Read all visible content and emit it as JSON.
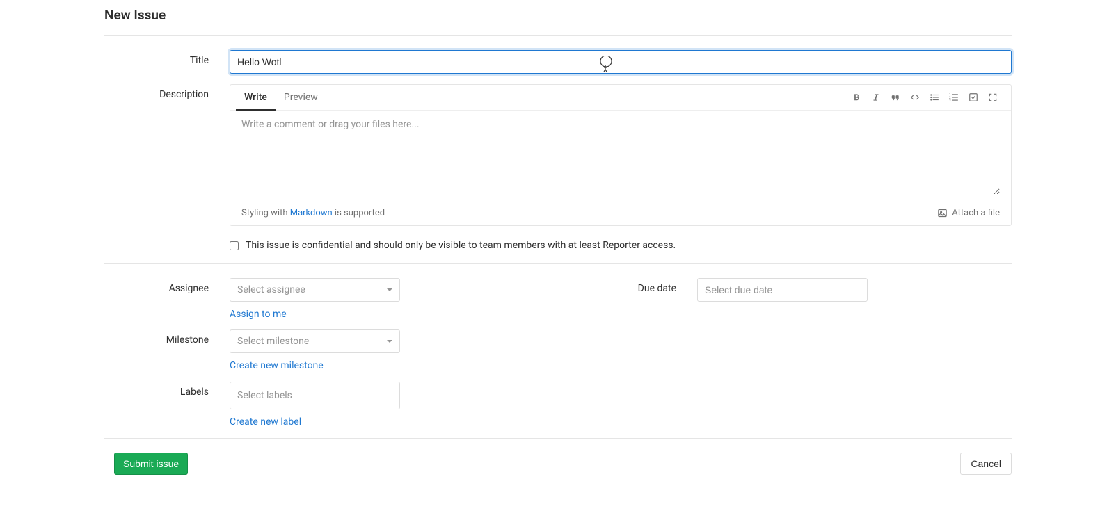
{
  "page": {
    "heading": "New Issue"
  },
  "form": {
    "titleLabel": "Title",
    "titleValue": "Hello Wotl",
    "descLabel": "Description",
    "tabs": {
      "write": "Write",
      "preview": "Preview"
    },
    "descPlaceholder": "Write a comment or drag your files here...",
    "markdownHint": {
      "prefix": "Styling with ",
      "link": "Markdown",
      "suffix": " is supported"
    },
    "attach": "Attach a file",
    "confidential": "This issue is confidential and should only be visible to team members with at least Reporter access.",
    "assignee": {
      "label": "Assignee",
      "placeholder": "Select assignee",
      "link": "Assign to me"
    },
    "dueDate": {
      "label": "Due date",
      "placeholder": "Select due date"
    },
    "milestone": {
      "label": "Milestone",
      "placeholder": "Select milestone",
      "link": "Create new milestone"
    },
    "labels": {
      "label": "Labels",
      "placeholder": "Select labels",
      "link": "Create new label"
    },
    "submit": "Submit issue",
    "cancel": "Cancel"
  }
}
